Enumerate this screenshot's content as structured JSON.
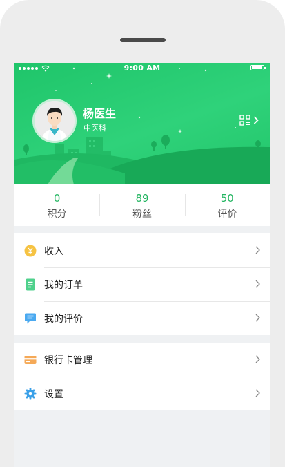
{
  "status_bar": {
    "time": "9:00 AM"
  },
  "profile": {
    "name": "杨医生",
    "department": "中医科"
  },
  "stats": [
    {
      "value": "0",
      "label": "积分"
    },
    {
      "value": "89",
      "label": "粉丝"
    },
    {
      "value": "50",
      "label": "评价"
    }
  ],
  "menu": {
    "group1": [
      {
        "label": "收入",
        "icon": "yen-coin-icon"
      },
      {
        "label": "我的订单",
        "icon": "order-list-icon"
      },
      {
        "label": "我的评价",
        "icon": "comment-icon"
      }
    ],
    "group2": [
      {
        "label": "银行卡管理",
        "icon": "bank-card-icon"
      },
      {
        "label": "设置",
        "icon": "gear-icon"
      }
    ]
  },
  "colors": {
    "brand_green": "#23b561",
    "header_green": "#2fd27a",
    "coin_yellow": "#f6c343",
    "order_green": "#4fd18c",
    "comment_blue": "#4aa9f0",
    "card_orange": "#f5a957",
    "gear_blue": "#3aa0e8"
  }
}
